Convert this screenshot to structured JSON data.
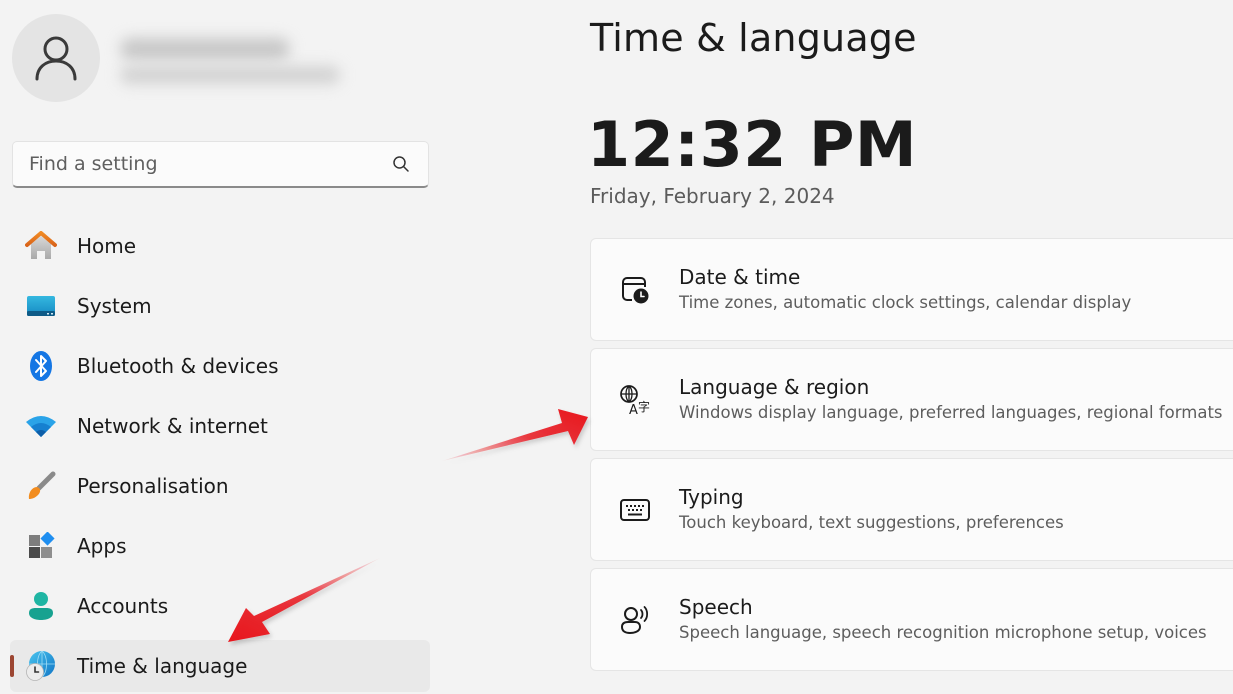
{
  "profile": {
    "avatar_icon": "person-icon",
    "name_redacted": true
  },
  "search": {
    "placeholder": "Find a setting",
    "value": "",
    "icon": "search-icon"
  },
  "sidebar": {
    "items": [
      {
        "label": "Home",
        "icon": "home-icon",
        "active": false
      },
      {
        "label": "System",
        "icon": "monitor-icon",
        "active": false
      },
      {
        "label": "Bluetooth & devices",
        "icon": "bluetooth-icon",
        "active": false
      },
      {
        "label": "Network & internet",
        "icon": "wifi-icon",
        "active": false
      },
      {
        "label": "Personalisation",
        "icon": "paintbrush-icon",
        "active": false
      },
      {
        "label": "Apps",
        "icon": "apps-icon",
        "active": false
      },
      {
        "label": "Accounts",
        "icon": "account-icon",
        "active": false
      },
      {
        "label": "Time & language",
        "icon": "globe-clock-icon",
        "active": true
      }
    ],
    "active_indicator_color": "#9c4632"
  },
  "main": {
    "title": "Time & language",
    "time": "12:32 PM",
    "date": "Friday, February 2, 2024",
    "cards": [
      {
        "title": "Date & time",
        "description": "Time zones, automatic clock settings, calendar display",
        "icon": "calendar-clock-icon"
      },
      {
        "title": "Language & region",
        "description": "Windows display language, preferred languages, regional formats",
        "icon": "language-icon"
      },
      {
        "title": "Typing",
        "description": "Touch keyboard, text suggestions, preferences",
        "icon": "keyboard-icon"
      },
      {
        "title": "Speech",
        "description": "Speech language, speech recognition microphone setup, voices",
        "icon": "speech-icon"
      }
    ]
  },
  "annotations": {
    "arrow_color": "#e8141c",
    "arrows": [
      {
        "points_to": "Time & language sidebar item"
      },
      {
        "points_to": "Language & region card"
      }
    ]
  }
}
